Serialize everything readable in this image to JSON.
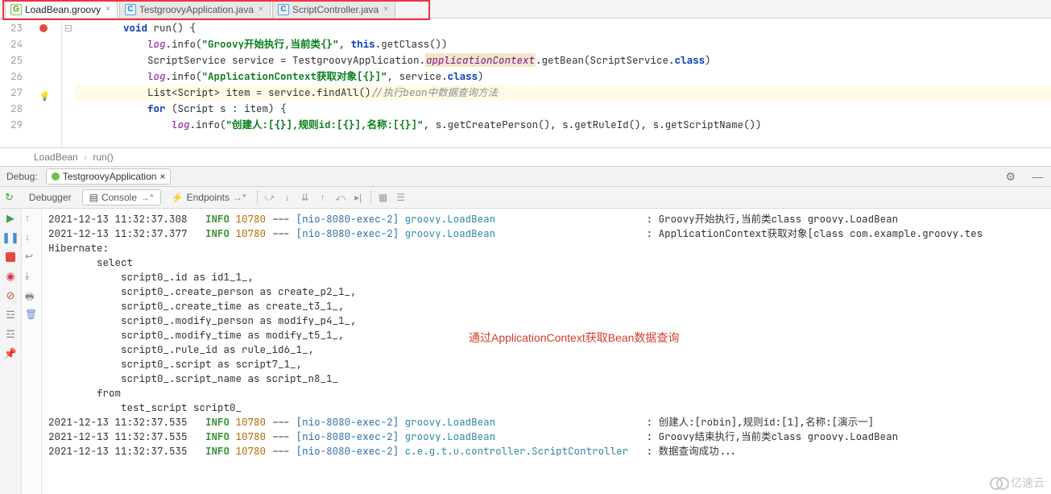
{
  "tabs": [
    {
      "label": "LoadBean.groovy",
      "kind": "g"
    },
    {
      "label": "TestgroovyApplication.java",
      "kind": "c"
    },
    {
      "label": "ScriptController.java",
      "kind": "c"
    }
  ],
  "editor": {
    "line_start": 23,
    "lines": [
      {
        "n": 23,
        "marks": "bp",
        "fold": "⊟",
        "ind": 2,
        "segs": [
          {
            "t": "void",
            "c": "kw"
          },
          {
            "t": " run() {"
          }
        ]
      },
      {
        "n": 24,
        "ind": 3,
        "segs": [
          {
            "t": "log",
            "c": "fld"
          },
          {
            "t": ".info("
          },
          {
            "t": "\"Groovy开始执行,当前类{}\"",
            "c": "str"
          },
          {
            "t": ", "
          },
          {
            "t": "this",
            "c": "kw"
          },
          {
            "t": ".getClass())"
          }
        ]
      },
      {
        "n": 25,
        "ind": 3,
        "segs": [
          {
            "t": "ScriptService service = TestgroovyApplication."
          },
          {
            "t": "applicationContext",
            "c": "fld hl"
          },
          {
            "t": ".getBean(ScriptService."
          },
          {
            "t": "class",
            "c": "kw"
          },
          {
            "t": ")"
          }
        ]
      },
      {
        "n": 26,
        "ind": 3,
        "segs": [
          {
            "t": "log",
            "c": "fld"
          },
          {
            "t": ".info("
          },
          {
            "t": "\"ApplicationContext获取对象[{}]\"",
            "c": "str"
          },
          {
            "t": ", service."
          },
          {
            "t": "class",
            "c": "kw"
          },
          {
            "t": ")"
          }
        ]
      },
      {
        "n": 27,
        "marks": "bulb",
        "hint": true,
        "ind": 3,
        "segs": [
          {
            "t": "List<Script> item = service.findAll()"
          },
          {
            "t": "//执行bean中数据查询方法",
            "c": "com"
          }
        ]
      },
      {
        "n": 28,
        "ind": 3,
        "segs": [
          {
            "t": "for",
            "c": "kw"
          },
          {
            "t": " (Script s : item) {"
          }
        ]
      },
      {
        "n": 29,
        "ind": 4,
        "segs": [
          {
            "t": "log",
            "c": "fld"
          },
          {
            "t": ".info("
          },
          {
            "t": "\"创建人:[{}],规则id:[{}],名称:[{}]\"",
            "c": "str"
          },
          {
            "t": ", s.getCreatePerson(), s.getRuleId(), s.getScriptName())"
          }
        ]
      }
    ]
  },
  "breadcrumb": [
    "LoadBean",
    "run()"
  ],
  "debug": {
    "label": "Debug:",
    "session": "TestgroovyApplication"
  },
  "run_tabs": {
    "debugger": "Debugger",
    "console": "Console",
    "endpoints": "Endpoints"
  },
  "console_annotation": "通过ApplicationContext获取Bean数据查询",
  "console_lines": [
    {
      "ts": "2021-12-13 11:32:37.308",
      "lvl": "INFO",
      "pid": "10780",
      "sep": "---",
      "thr": "[nio-8080-exec-2]",
      "logger": "groovy.LoadBean",
      "msg": ": Groovy开始执行,当前类class groovy.LoadBean",
      "indent": 0
    },
    {
      "ts": "2021-12-13 11:32:37.377",
      "lvl": "INFO",
      "pid": "10780",
      "sep": "---",
      "thr": "[nio-8080-exec-2]",
      "logger": "groovy.LoadBean",
      "msg": ": ApplicationContext获取对象[class com.example.groovy.tes",
      "indent": 0
    },
    {
      "raw": "Hibernate:",
      "indent": 0
    },
    {
      "raw": "select",
      "indent": 2
    },
    {
      "raw": "script0_.id as id1_1_,",
      "indent": 3
    },
    {
      "raw": "script0_.create_person as create_p2_1_,",
      "indent": 3
    },
    {
      "raw": "script0_.create_time as create_t3_1_,",
      "indent": 3
    },
    {
      "raw": "script0_.modify_person as modify_p4_1_,",
      "indent": 3
    },
    {
      "raw": "script0_.modify_time as modify_t5_1_,",
      "indent": 3
    },
    {
      "raw": "script0_.rule_id as rule_id6_1_,",
      "indent": 3
    },
    {
      "raw": "script0_.script as script7_1_,",
      "indent": 3
    },
    {
      "raw": "script0_.script_name as script_n8_1_",
      "indent": 3
    },
    {
      "raw": "from",
      "indent": 2
    },
    {
      "raw": "test_script script0_",
      "indent": 3
    },
    {
      "ts": "2021-12-13 11:32:37.535",
      "lvl": "INFO",
      "pid": "10780",
      "sep": "---",
      "thr": "[nio-8080-exec-2]",
      "logger": "groovy.LoadBean",
      "msg": ": 创建人:[robin],规则id:[1],名称:[演示一]",
      "indent": 0
    },
    {
      "ts": "2021-12-13 11:32:37.535",
      "lvl": "INFO",
      "pid": "10780",
      "sep": "---",
      "thr": "[nio-8080-exec-2]",
      "logger": "groovy.LoadBean",
      "msg": ": Groovy结束执行,当前类class groovy.LoadBean",
      "indent": 0
    },
    {
      "ts": "2021-12-13 11:32:37.535",
      "lvl": "INFO",
      "pid": "10780",
      "sep": "---",
      "thr": "[nio-8080-exec-2]",
      "logger": "c.e.g.t.u.controller.ScriptController",
      "msg": ": 数据查询成功...",
      "indent": 0
    }
  ],
  "watermark": "亿速云"
}
